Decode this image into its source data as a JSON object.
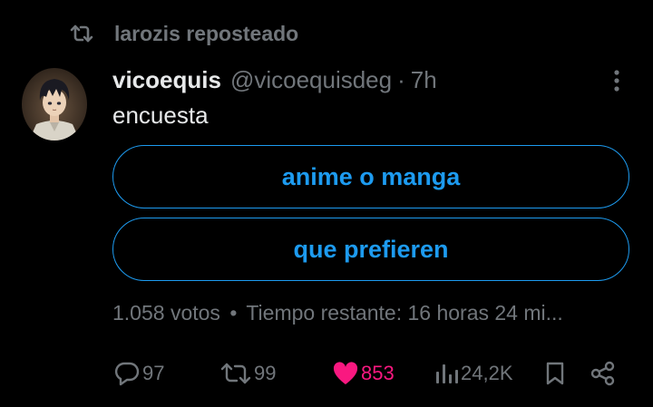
{
  "repost": {
    "label": "larozis reposteado",
    "icon": "repost-icon"
  },
  "tweet": {
    "display_name": "vicoequis",
    "handle": "@vicoequisdeg",
    "separator": "·",
    "time": "7h",
    "text": "encuesta",
    "avatar_icon": "avatar-anime-character"
  },
  "poll": {
    "options": [
      {
        "label": "anime o manga"
      },
      {
        "label": "que prefieren"
      }
    ],
    "votes": "1.058 votos",
    "dot": "•",
    "time_left": "Tiempo restante: 16 horas 24 mi..."
  },
  "actions": {
    "replies": "97",
    "reposts": "99",
    "likes": "853",
    "views": "24,2K"
  },
  "colors": {
    "background": "#000000",
    "accent": "#1d9bf0",
    "muted": "#71767b",
    "text": "#e7e9ea",
    "like": "#f91880"
  }
}
